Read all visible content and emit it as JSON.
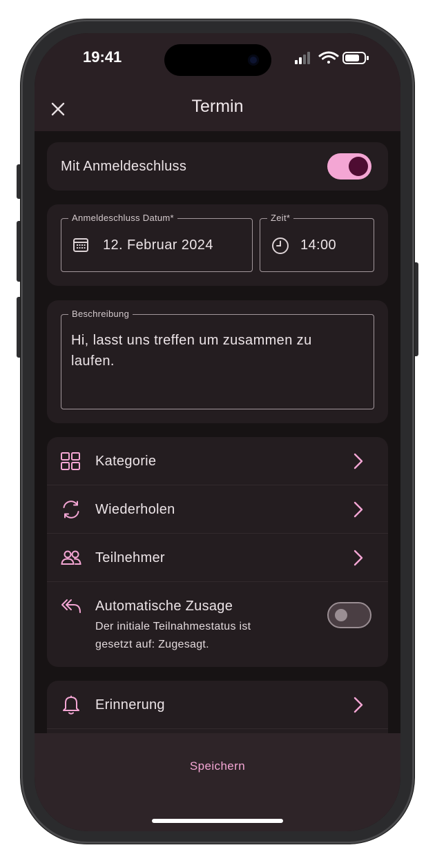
{
  "status_bar": {
    "time": "19:41",
    "icons": [
      "signal-icon",
      "wifi-icon",
      "battery-icon"
    ]
  },
  "app_bar": {
    "title": "Termin",
    "close_icon": "close-icon"
  },
  "deadline_toggle": {
    "label": "Mit Anmeldeschluss",
    "enabled": true
  },
  "deadline": {
    "date_label": "Anmeldeschluss Datum*",
    "date_value": "12. Februar 2024",
    "time_label": "Zeit*",
    "time_value": "14:00"
  },
  "description": {
    "label": "Beschreibung",
    "line1": "Hi, lasst uns treffen um zusammen zu",
    "line2": "laufen."
  },
  "options": {
    "category": "Kategorie",
    "repeat": "Wiederholen",
    "participants": "Teilnehmer",
    "auto_accept": {
      "label": "Automatische Zusage",
      "line1": "Der initiale Teilnahmestatus ist",
      "line2": "gesetzt auf: Zugesagt.",
      "enabled": false
    }
  },
  "reminder": {
    "label": "Erinnerung"
  },
  "footer": {
    "save_label": "Speichern"
  },
  "colors": {
    "accent": "#f4a6d4",
    "background": "#171314",
    "card": "#241d20",
    "app_bar": "#2a2024"
  }
}
